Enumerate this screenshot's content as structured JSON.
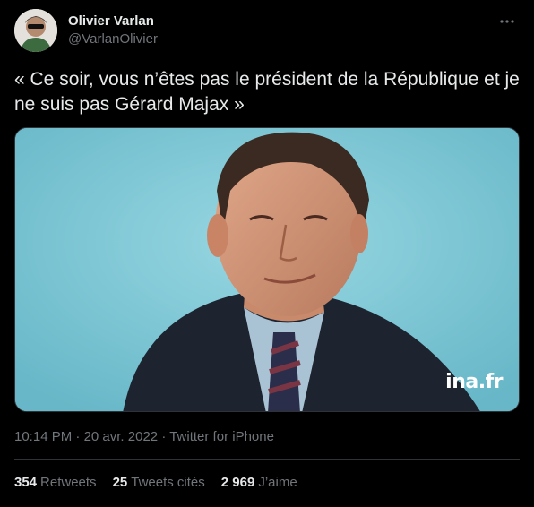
{
  "author": {
    "name": "Olivier Varlan",
    "handle": "@VarlanOlivier"
  },
  "tweet": {
    "text": "« Ce soir, vous n’êtes pas le président de la République et je ne suis pas Gérard Majax »"
  },
  "media": {
    "watermark": "ina.fr"
  },
  "meta": {
    "time": "10:14 PM",
    "date": "20 avr. 2022",
    "source": "Twitter for iPhone",
    "separator": "·"
  },
  "stats": [
    {
      "count": "354",
      "label": "Retweets"
    },
    {
      "count": "25",
      "label": "Tweets cités"
    },
    {
      "count": "2 969",
      "label": "J’aime"
    }
  ],
  "icons": {
    "more": "more-options-icon"
  }
}
